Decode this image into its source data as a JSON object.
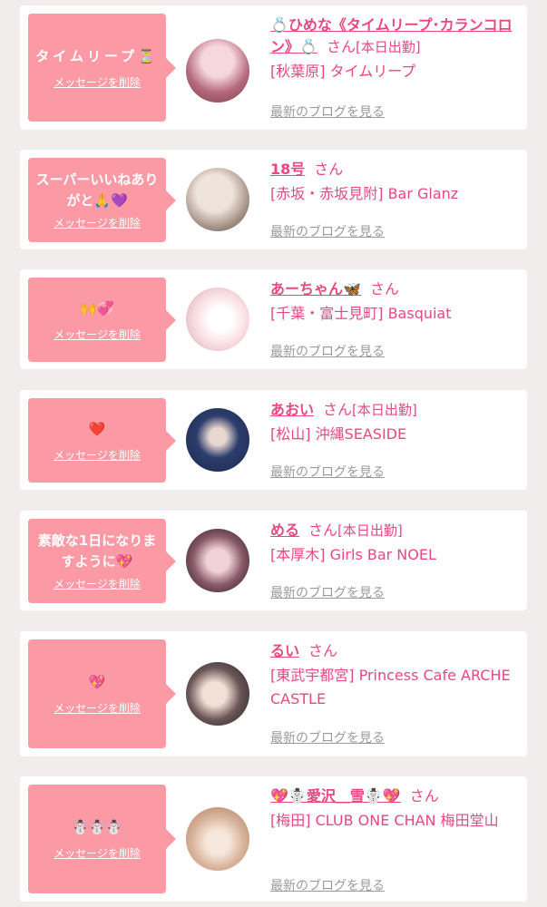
{
  "cards": [
    {
      "message": "タイムリープ⏳",
      "delete_label": "メッセージを削除",
      "name": "💍ひめな《タイムリープ･カランコロン》💍",
      "honorific": "さん",
      "status": "[本日出勤]",
      "shop": "[秋葉原] タイムリープ",
      "blog_link": "最新のブログを見る",
      "avatar_colors": [
        "#f4c9d6",
        "#7a3e4d"
      ]
    },
    {
      "message": "スーパーいいねありがと🙏💜",
      "delete_label": "メッセージを削除",
      "name": "18号",
      "honorific": "さん",
      "status": "",
      "shop": "[赤坂・赤坂見附] Bar Glanz",
      "blog_link": "最新のブログを見る",
      "avatar_colors": [
        "#e8ddd5",
        "#5a4a42"
      ]
    },
    {
      "message": "🙌💞",
      "delete_label": "メッセージを削除",
      "name": "あーちゃん🦋",
      "honorific": "さん",
      "status": "",
      "shop": "[千葉・富士見町] Basquiat",
      "blog_link": "最新のブログを見る",
      "avatar_colors": [
        "#fbeef0",
        "#d9a7b0"
      ]
    },
    {
      "message": "❤️",
      "delete_label": "メッセージを削除",
      "name": "あおい",
      "honorific": "さん",
      "status": "[本日出勤]",
      "shop": "[松山] 沖縄SEASIDE",
      "blog_link": "最新のブログを見る",
      "avatar_colors": [
        "#1c2a4d",
        "#4a6fb0"
      ]
    },
    {
      "message": "素敵な1日になりますように💖",
      "delete_label": "メッセージを削除",
      "name": "める",
      "honorific": "さん",
      "status": "[本日出勤]",
      "shop": "[本厚木] Girls Bar NOEL",
      "blog_link": "最新のブログを見る",
      "avatar_colors": [
        "#221a22",
        "#c58fa0"
      ]
    },
    {
      "message": "💖",
      "delete_label": "メッセージを削除",
      "name": "るい",
      "honorific": "さん",
      "status": "",
      "shop": "[東武宇都宮] Princess Cafe ARCHE CASTLE",
      "blog_link": "最新のブログを見る",
      "avatar_colors": [
        "#2a2222",
        "#e6d3c8"
      ]
    },
    {
      "message": "☃️☃️☃️",
      "delete_label": "メッセージを削除",
      "name": "💖☃️愛沢＿雪☃️💖",
      "honorific": "さん",
      "status": "",
      "shop": "[梅田] CLUB ONE CHAN 梅田堂山",
      "blog_link": "最新のブログを見る",
      "avatar_colors": [
        "#f1dfd4",
        "#b07a5e"
      ]
    }
  ]
}
